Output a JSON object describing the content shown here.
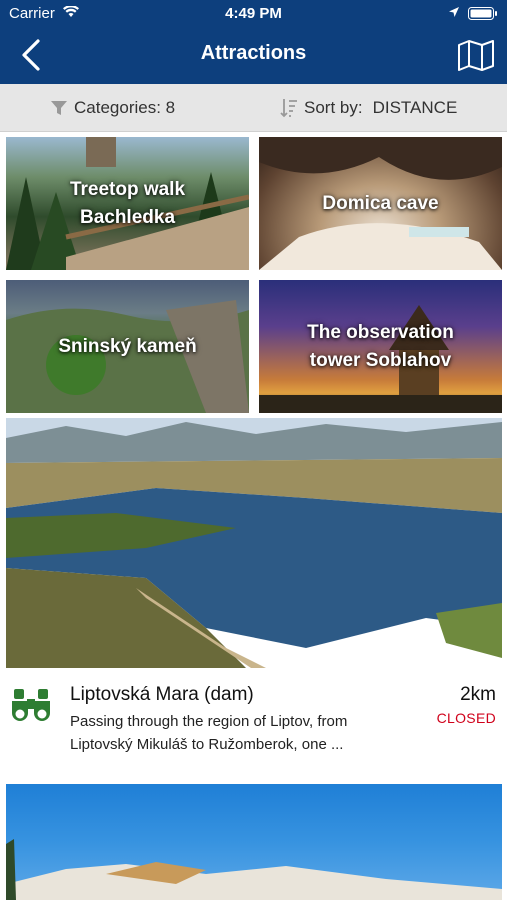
{
  "status_bar": {
    "carrier": "Carrier",
    "time": "4:49 PM"
  },
  "nav": {
    "title": "Attractions"
  },
  "filter": {
    "categories_label": "Categories: 8",
    "sort_label": "Sort by:",
    "sort_value": "DISTANCE"
  },
  "tiles": [
    {
      "label_line1": "Treetop walk",
      "label_line2": "Bachledka"
    },
    {
      "label_line1": "Domica cave",
      "label_line2": ""
    },
    {
      "label_line1": "Sninský kameň",
      "label_line2": ""
    },
    {
      "label_line1": "The observation",
      "label_line2": "tower Soblahov"
    }
  ],
  "featured": {
    "title": "Liptovská Mara (dam)",
    "distance": "2km",
    "status": "CLOSED",
    "description_line1": "Passing through the region of Liptov, from",
    "description_line2": "Liptovský Mikuláš to Ružomberok, one ...",
    "icon": "binoculars-icon"
  },
  "colors": {
    "nav_bg": "#0d3f7d",
    "status_closed": "#d0021b",
    "icon_green": "#2e7d32"
  }
}
